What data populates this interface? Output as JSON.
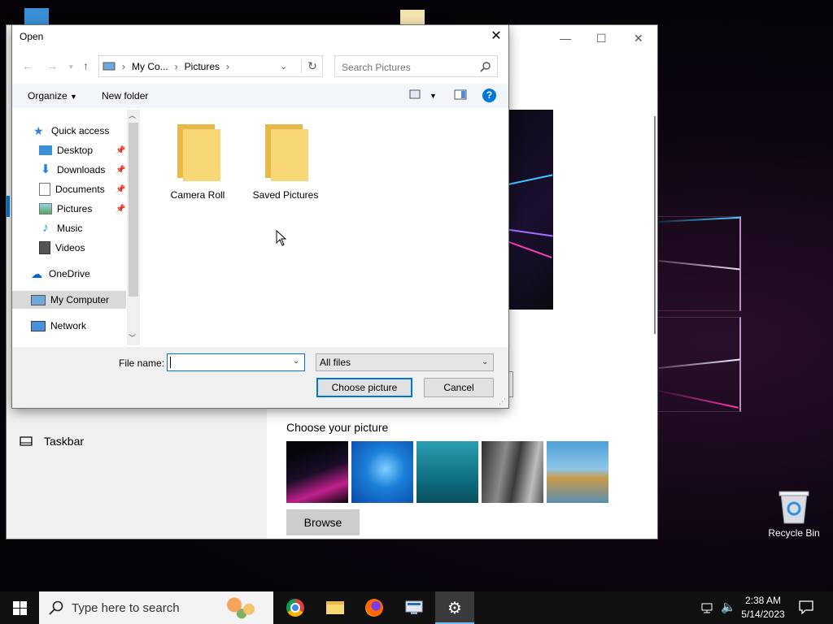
{
  "dialog": {
    "title": "Open",
    "breadcrumb": [
      "My Co...",
      "Pictures"
    ],
    "search_placeholder": "Search Pictures",
    "commands": {
      "organize": "Organize",
      "new_folder": "New folder"
    },
    "nav": {
      "quick_access": "Quick access",
      "items": [
        {
          "label": "Desktop"
        },
        {
          "label": "Downloads"
        },
        {
          "label": "Documents"
        },
        {
          "label": "Pictures"
        },
        {
          "label": "Music"
        },
        {
          "label": "Videos"
        }
      ],
      "onedrive": "OneDrive",
      "my_computer": "My Computer",
      "network": "Network"
    },
    "folders": [
      {
        "label": "Camera Roll"
      },
      {
        "label": "Saved Pictures"
      }
    ],
    "file_name_label": "File name:",
    "file_name_value": "",
    "file_type": "All files",
    "choose_button": "Choose picture",
    "cancel_button": "Cancel"
  },
  "settings": {
    "taskbar_label": "Taskbar",
    "choose_picture_title": "Choose your picture",
    "browse_button": "Browse"
  },
  "desktop": {
    "recycle_bin": "Recycle Bin"
  },
  "taskbar": {
    "search_placeholder": "Type here to search",
    "time": "2:38 AM",
    "date": "5/14/2023"
  },
  "colors": {
    "accent": "#0078d7",
    "folder_yellow": "#f8d775",
    "taskbar_bg": "#101010"
  }
}
